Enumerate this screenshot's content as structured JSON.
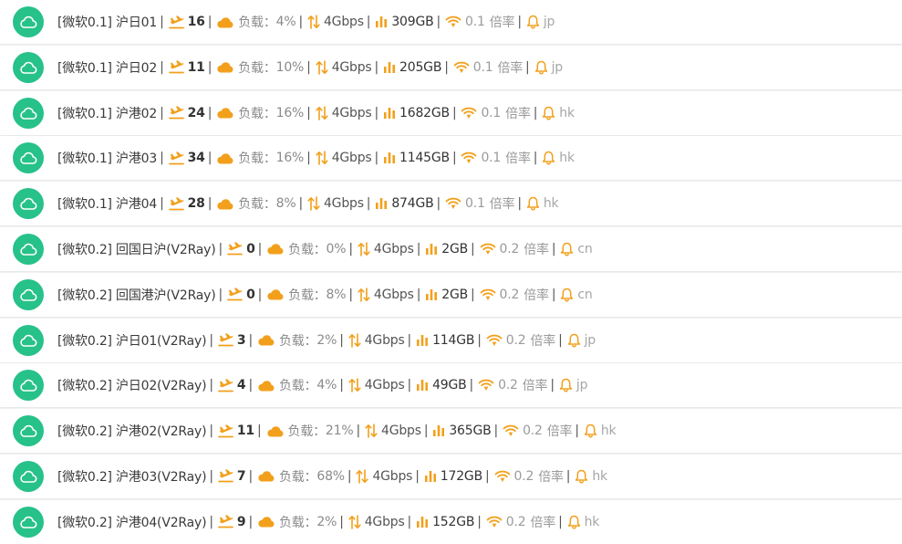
{
  "labels": {
    "load": "负载：",
    "rate_suffix": "倍率",
    "separator": "|"
  },
  "colors": {
    "status_green": "#27c18a",
    "accent_orange": "#f2a01c"
  },
  "icons": {
    "status": "cloud-icon",
    "online": "airplane-icon",
    "load": "cloud-icon",
    "bandwidth": "up-down-arrows-icon",
    "traffic": "bar-chart-icon",
    "rate": "signal-icon",
    "region": "bell-icon"
  },
  "nodes": [
    {
      "name": "[微软0.1] 沪日01",
      "online": "16",
      "load": "4%",
      "bandwidth": "4Gbps",
      "traffic": "309GB",
      "rate": "0.1",
      "region": "jp"
    },
    {
      "name": "[微软0.1] 沪日02",
      "online": "11",
      "load": "10%",
      "bandwidth": "4Gbps",
      "traffic": "205GB",
      "rate": "0.1",
      "region": "jp"
    },
    {
      "name": "[微软0.1] 沪港02",
      "online": "24",
      "load": "16%",
      "bandwidth": "4Gbps",
      "traffic": "1682GB",
      "rate": "0.1",
      "region": "hk"
    },
    {
      "name": "[微软0.1] 沪港03",
      "online": "34",
      "load": "16%",
      "bandwidth": "4Gbps",
      "traffic": "1145GB",
      "rate": "0.1",
      "region": "hk"
    },
    {
      "name": "[微软0.1] 沪港04",
      "online": "28",
      "load": "8%",
      "bandwidth": "4Gbps",
      "traffic": "874GB",
      "rate": "0.1",
      "region": "hk"
    },
    {
      "name": "[微软0.2] 回国日沪(V2Ray)",
      "online": "0",
      "load": "0%",
      "bandwidth": "4Gbps",
      "traffic": "2GB",
      "rate": "0.2",
      "region": "cn"
    },
    {
      "name": "[微软0.2] 回国港沪(V2Ray)",
      "online": "0",
      "load": "8%",
      "bandwidth": "4Gbps",
      "traffic": "2GB",
      "rate": "0.2",
      "region": "cn"
    },
    {
      "name": "[微软0.2] 沪日01(V2Ray)",
      "online": "3",
      "load": "2%",
      "bandwidth": "4Gbps",
      "traffic": "114GB",
      "rate": "0.2",
      "region": "jp"
    },
    {
      "name": "[微软0.2] 沪日02(V2Ray)",
      "online": "4",
      "load": "4%",
      "bandwidth": "4Gbps",
      "traffic": "49GB",
      "rate": "0.2",
      "region": "jp"
    },
    {
      "name": "[微软0.2] 沪港02(V2Ray)",
      "online": "11",
      "load": "21%",
      "bandwidth": "4Gbps",
      "traffic": "365GB",
      "rate": "0.2",
      "region": "hk"
    },
    {
      "name": "[微软0.2] 沪港03(V2Ray)",
      "online": "7",
      "load": "68%",
      "bandwidth": "4Gbps",
      "traffic": "172GB",
      "rate": "0.2",
      "region": "hk"
    },
    {
      "name": "[微软0.2] 沪港04(V2Ray)",
      "online": "9",
      "load": "2%",
      "bandwidth": "4Gbps",
      "traffic": "152GB",
      "rate": "0.2",
      "region": "hk"
    }
  ]
}
